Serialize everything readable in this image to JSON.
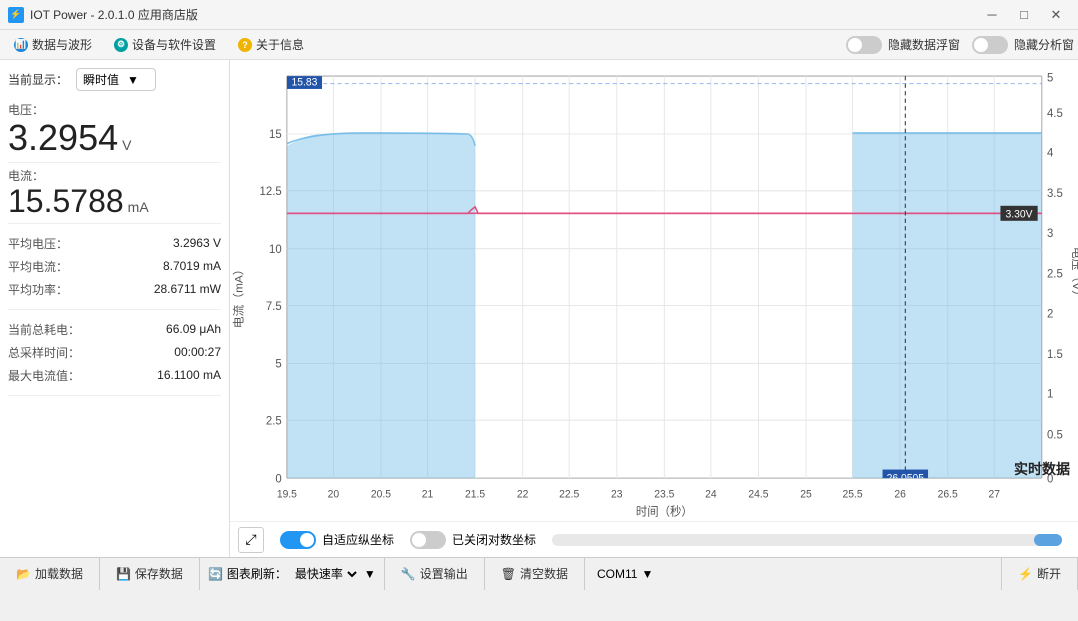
{
  "window": {
    "title": "IOT Power - 2.0.1.0 应用商店版",
    "controls": {
      "minimize": "─",
      "maximize": "□",
      "close": "✕"
    }
  },
  "menu": {
    "items": [
      {
        "id": "data-waveform",
        "icon": "📊",
        "icon_color": "blue",
        "label": "数据与波形"
      },
      {
        "id": "device-settings",
        "icon": "⚙",
        "icon_color": "teal",
        "label": "设备与软件设置"
      },
      {
        "id": "about",
        "icon": "?",
        "icon_color": "yellow",
        "label": "关于信息"
      }
    ],
    "toggles": [
      {
        "id": "hide-data",
        "label": "隐藏数据浮窗",
        "on": false
      },
      {
        "id": "hide-analysis",
        "label": "隐藏分析窗",
        "on": false
      }
    ]
  },
  "left_panel": {
    "display_label": "当前显示：",
    "display_mode": "瞬时值",
    "voltage_label": "电压：",
    "voltage_value": "3.2954",
    "voltage_unit": "V",
    "current_label": "电流：",
    "current_value": "15.5788",
    "current_unit": "mA",
    "stats": [
      {
        "label": "平均电压：",
        "value": "3.2963",
        "unit": "V"
      },
      {
        "label": "平均电流：",
        "value": "8.7019",
        "unit": "mA"
      },
      {
        "label": "平均功率：",
        "value": "28.6711",
        "unit": "mW"
      }
    ],
    "extra": [
      {
        "label": "当前总耗电：",
        "value": "66.09",
        "unit": "μAh"
      },
      {
        "label": "总采样时间：",
        "value": "00:00:27",
        "unit": ""
      },
      {
        "label": "最大电流值：",
        "value": "16.1100",
        "unit": "mA"
      }
    ]
  },
  "chart": {
    "y_axis_label": "电流（mA）",
    "y_axis_right_label": "电压（V）",
    "x_axis_label": "时间（秒）",
    "x_ticks": [
      "19.5",
      "20",
      "20.5",
      "21",
      "21.5",
      "22",
      "22.5",
      "23",
      "23.5",
      "24",
      "24.5",
      "25",
      "25.5",
      "26",
      "26.5",
      "27"
    ],
    "y_ticks": [
      "0",
      "2.5",
      "5",
      "7.5",
      "10",
      "12.5",
      "15"
    ],
    "y_right_ticks": [
      "0",
      "0.5",
      "1",
      "1.5",
      "2",
      "2.5",
      "3",
      "3.5",
      "4",
      "4.5",
      "5"
    ],
    "voltage_label": "3.30V",
    "peak_label": "15.83",
    "time_marker": "26.0505",
    "realtime_label": "实时数据",
    "controls": {
      "adaptive_label": "自适应纵坐标",
      "adaptive_on": true,
      "log_label": "已关闭对数坐标",
      "log_on": false
    }
  },
  "bottom_bar": {
    "load_data": "加载数据",
    "save_data": "保存数据",
    "chart_refresh_label": "图表刷新：",
    "chart_refresh_value": "最快速率",
    "set_output": "设置输出",
    "clear_data": "清空数据",
    "com_port": "COM11",
    "disconnect": "断开"
  }
}
